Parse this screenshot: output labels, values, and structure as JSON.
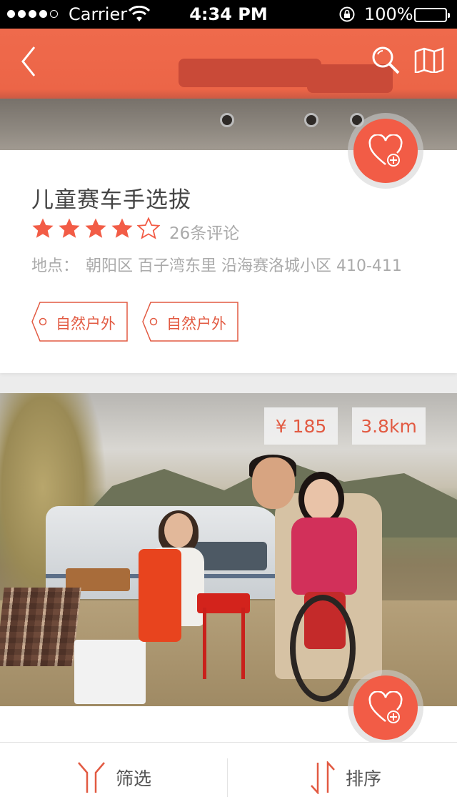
{
  "status_bar": {
    "carrier": "Carrier",
    "time": "4:34 PM",
    "battery": "100%",
    "signal_dots": 5,
    "signal_filled": 4
  },
  "top_nav": {
    "back_icon": "chevron-left-icon",
    "search_icon": "search-icon",
    "map_icon": "map-icon"
  },
  "activity1": {
    "title": "儿童赛车手选拔",
    "rating": 4,
    "rating_max": 5,
    "reviews": "26条评论",
    "location_label": "地点：",
    "location": "朝阳区 百子湾东里 沿海赛洛城小区 410-411",
    "tags": [
      "自然户外",
      "自然户外"
    ]
  },
  "activity2": {
    "price": "¥ 185",
    "distance": "3.8km"
  },
  "bottom_bar": {
    "filter_label": "筛选",
    "sort_label": "排序"
  },
  "colors": {
    "accent": "#f25c46",
    "star": "#f25c46",
    "text_muted": "#aaaaaa"
  }
}
